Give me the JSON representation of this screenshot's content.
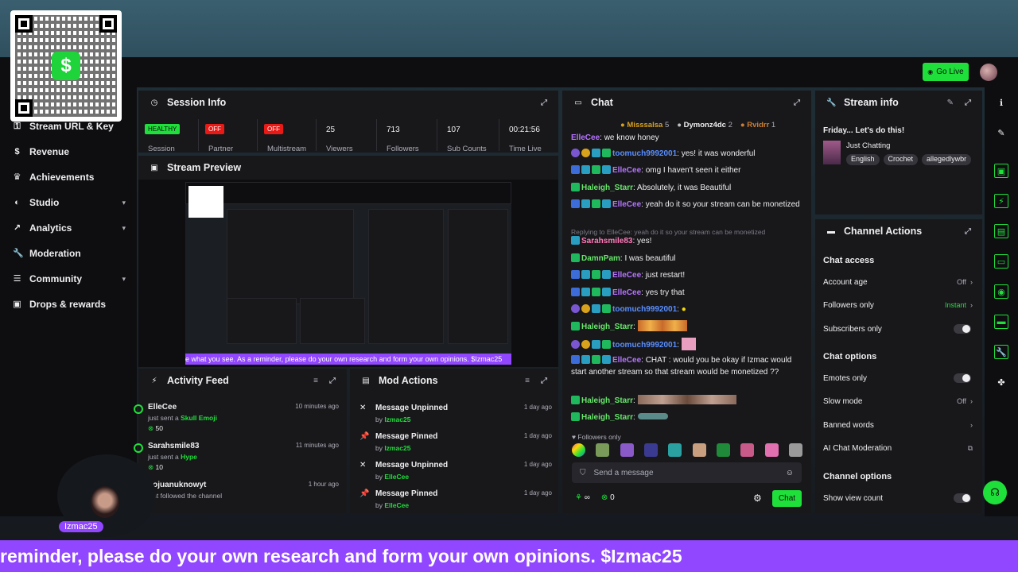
{
  "header": {
    "go_live_label": "Go Live"
  },
  "sidebar": {
    "items": [
      {
        "label": "Stream URL & Key",
        "icon": "key-icon",
        "chevron": false
      },
      {
        "label": "Revenue",
        "icon": "dollar-icon",
        "chevron": false
      },
      {
        "label": "Achievements",
        "icon": "trophy-icon",
        "chevron": false
      },
      {
        "label": "Studio",
        "icon": "studio-icon",
        "chevron": true
      },
      {
        "label": "Analytics",
        "icon": "analytics-icon",
        "chevron": true
      },
      {
        "label": "Moderation",
        "icon": "wrench-icon",
        "chevron": false
      },
      {
        "label": "Community",
        "icon": "community-icon",
        "chevron": true
      },
      {
        "label": "Drops & rewards",
        "icon": "gift-icon",
        "chevron": false
      }
    ]
  },
  "session_info": {
    "title": "Session Info",
    "stats": [
      {
        "badge": "HEALTHY",
        "badge_color": "#1fe03a",
        "label": "Session"
      },
      {
        "badge": "OFF",
        "badge_color": "#e91916",
        "label": "Partner"
      },
      {
        "badge": "OFF",
        "badge_color": "#e91916",
        "label": "Multistream"
      },
      {
        "value": "25",
        "label": "Viewers"
      },
      {
        "value": "713",
        "label": "Followers"
      },
      {
        "value": "107",
        "label": "Sub Counts"
      },
      {
        "value": "00:21:56",
        "label": "Time Live"
      }
    ]
  },
  "stream_preview": {
    "title": "Stream Preview",
    "caption": "e what you see. As a reminder, please do your own research and form your own opinions. $Izmac25"
  },
  "activity_feed": {
    "title": "Activity Feed",
    "items": [
      {
        "name": "ElleCee",
        "action": "just sent a ",
        "item": "Skull Emoji",
        "amount": "50",
        "time": "10 minutes ago"
      },
      {
        "name": "Sarahsmile83",
        "action": "just sent a ",
        "item": "Hype",
        "amount": "10",
        "time": "11 minutes ago"
      },
      {
        "name": "nojuanuknowyt",
        "action": "just followed the channel",
        "item": "",
        "amount": "",
        "time": "1 hour ago"
      }
    ]
  },
  "mod_actions": {
    "title": "Mod Actions",
    "items": [
      {
        "action": "Message Unpinned",
        "by": "Izmac25",
        "time": "1 day ago",
        "icon": "unpin-icon"
      },
      {
        "action": "Message Pinned",
        "by": "Izmac25",
        "time": "1 day ago",
        "icon": "pin-icon"
      },
      {
        "action": "Message Unpinned",
        "by": "ElleCee",
        "time": "1 day ago",
        "icon": "unpin-icon"
      },
      {
        "action": "Message Pinned",
        "by": "ElleCee",
        "time": "1 day ago",
        "icon": "pin-icon"
      }
    ]
  },
  "chat": {
    "title": "Chat",
    "leaderboard": [
      {
        "name": "Misssalsa",
        "rank": "5"
      },
      {
        "name": "Dymonz4dc",
        "rank": "2"
      },
      {
        "name": "Rvidrr",
        "rank": "1"
      }
    ],
    "messages": [
      {
        "user": "ElleCee",
        "color": "purple",
        "text": ": we know honey"
      },
      {
        "user": "toomuch9992001",
        "color": "blue",
        "text": ": yes! it was wonderful"
      },
      {
        "user": "ElleCee",
        "color": "purple",
        "text": ": omg I haven't seen it either"
      },
      {
        "user": "Haleigh_Starr",
        "color": "green",
        "text": ": Absolutely, it was Beautiful"
      },
      {
        "user": "ElleCee",
        "color": "purple",
        "text": ": yeah do it so your stream can be monetized"
      },
      {
        "reply": "Replying to ElleCee: yeah do it so your stream can be monetized"
      },
      {
        "user": "Sarahsmile83",
        "color": "pink",
        "text": ": yes!"
      },
      {
        "user": "DamnPam",
        "color": "green",
        "text": ": I was beautiful"
      },
      {
        "user": "ElleCee",
        "color": "purple",
        "text": ": just restart!"
      },
      {
        "user": "ElleCee",
        "color": "purple",
        "text": ": yes try that"
      },
      {
        "user": "toomuch9992001",
        "color": "blue",
        "text": ":"
      },
      {
        "user": "Haleigh_Starr",
        "color": "green",
        "text": ":"
      },
      {
        "user": "toomuch9992001",
        "color": "blue",
        "text": ":"
      },
      {
        "user": "ElleCee",
        "color": "purple",
        "text": ": CHAT : would you be okay if Izmac would start another stream so that stream would be monetized ??"
      },
      {
        "user": "Haleigh_Starr",
        "color": "green",
        "text": ":"
      },
      {
        "user": "Haleigh_Starr",
        "color": "green",
        "text": ":"
      }
    ],
    "followers_only_label": "Followers only",
    "input_placeholder": "Send a message",
    "points_left": "∞",
    "points_right": "0",
    "send_label": "Chat"
  },
  "stream_info": {
    "title": "Stream info",
    "stream_title": "Friday... Let's do this!",
    "category": "Just Chatting",
    "tags": [
      "English",
      "Crochet",
      "allegedlywbr"
    ]
  },
  "channel_actions": {
    "title": "Channel Actions",
    "chat_access_heading": "Chat access",
    "account_age": {
      "label": "Account age",
      "value": "Off"
    },
    "followers_only": {
      "label": "Followers only",
      "value": "Instant"
    },
    "subscribers_only": {
      "label": "Subscribers only"
    },
    "chat_options_heading": "Chat options",
    "emotes_only": {
      "label": "Emotes only"
    },
    "slow_mode": {
      "label": "Slow mode",
      "value": "Off"
    },
    "banned_words": {
      "label": "Banned words"
    },
    "ai_moderation": {
      "label": "AI Chat Moderation"
    },
    "channel_options_heading": "Channel options",
    "show_view_count": {
      "label": "Show view count"
    }
  },
  "overlay": {
    "ticker_text": "reminder, please do your own research and form your own opinions. $Izmac25",
    "cam_tag": "Izmac25",
    "qr_symbol": "$"
  },
  "colors": {
    "accent": "#1fe03a",
    "brand": "#9146ff",
    "panel": "#18181b",
    "danger": "#e91916"
  }
}
